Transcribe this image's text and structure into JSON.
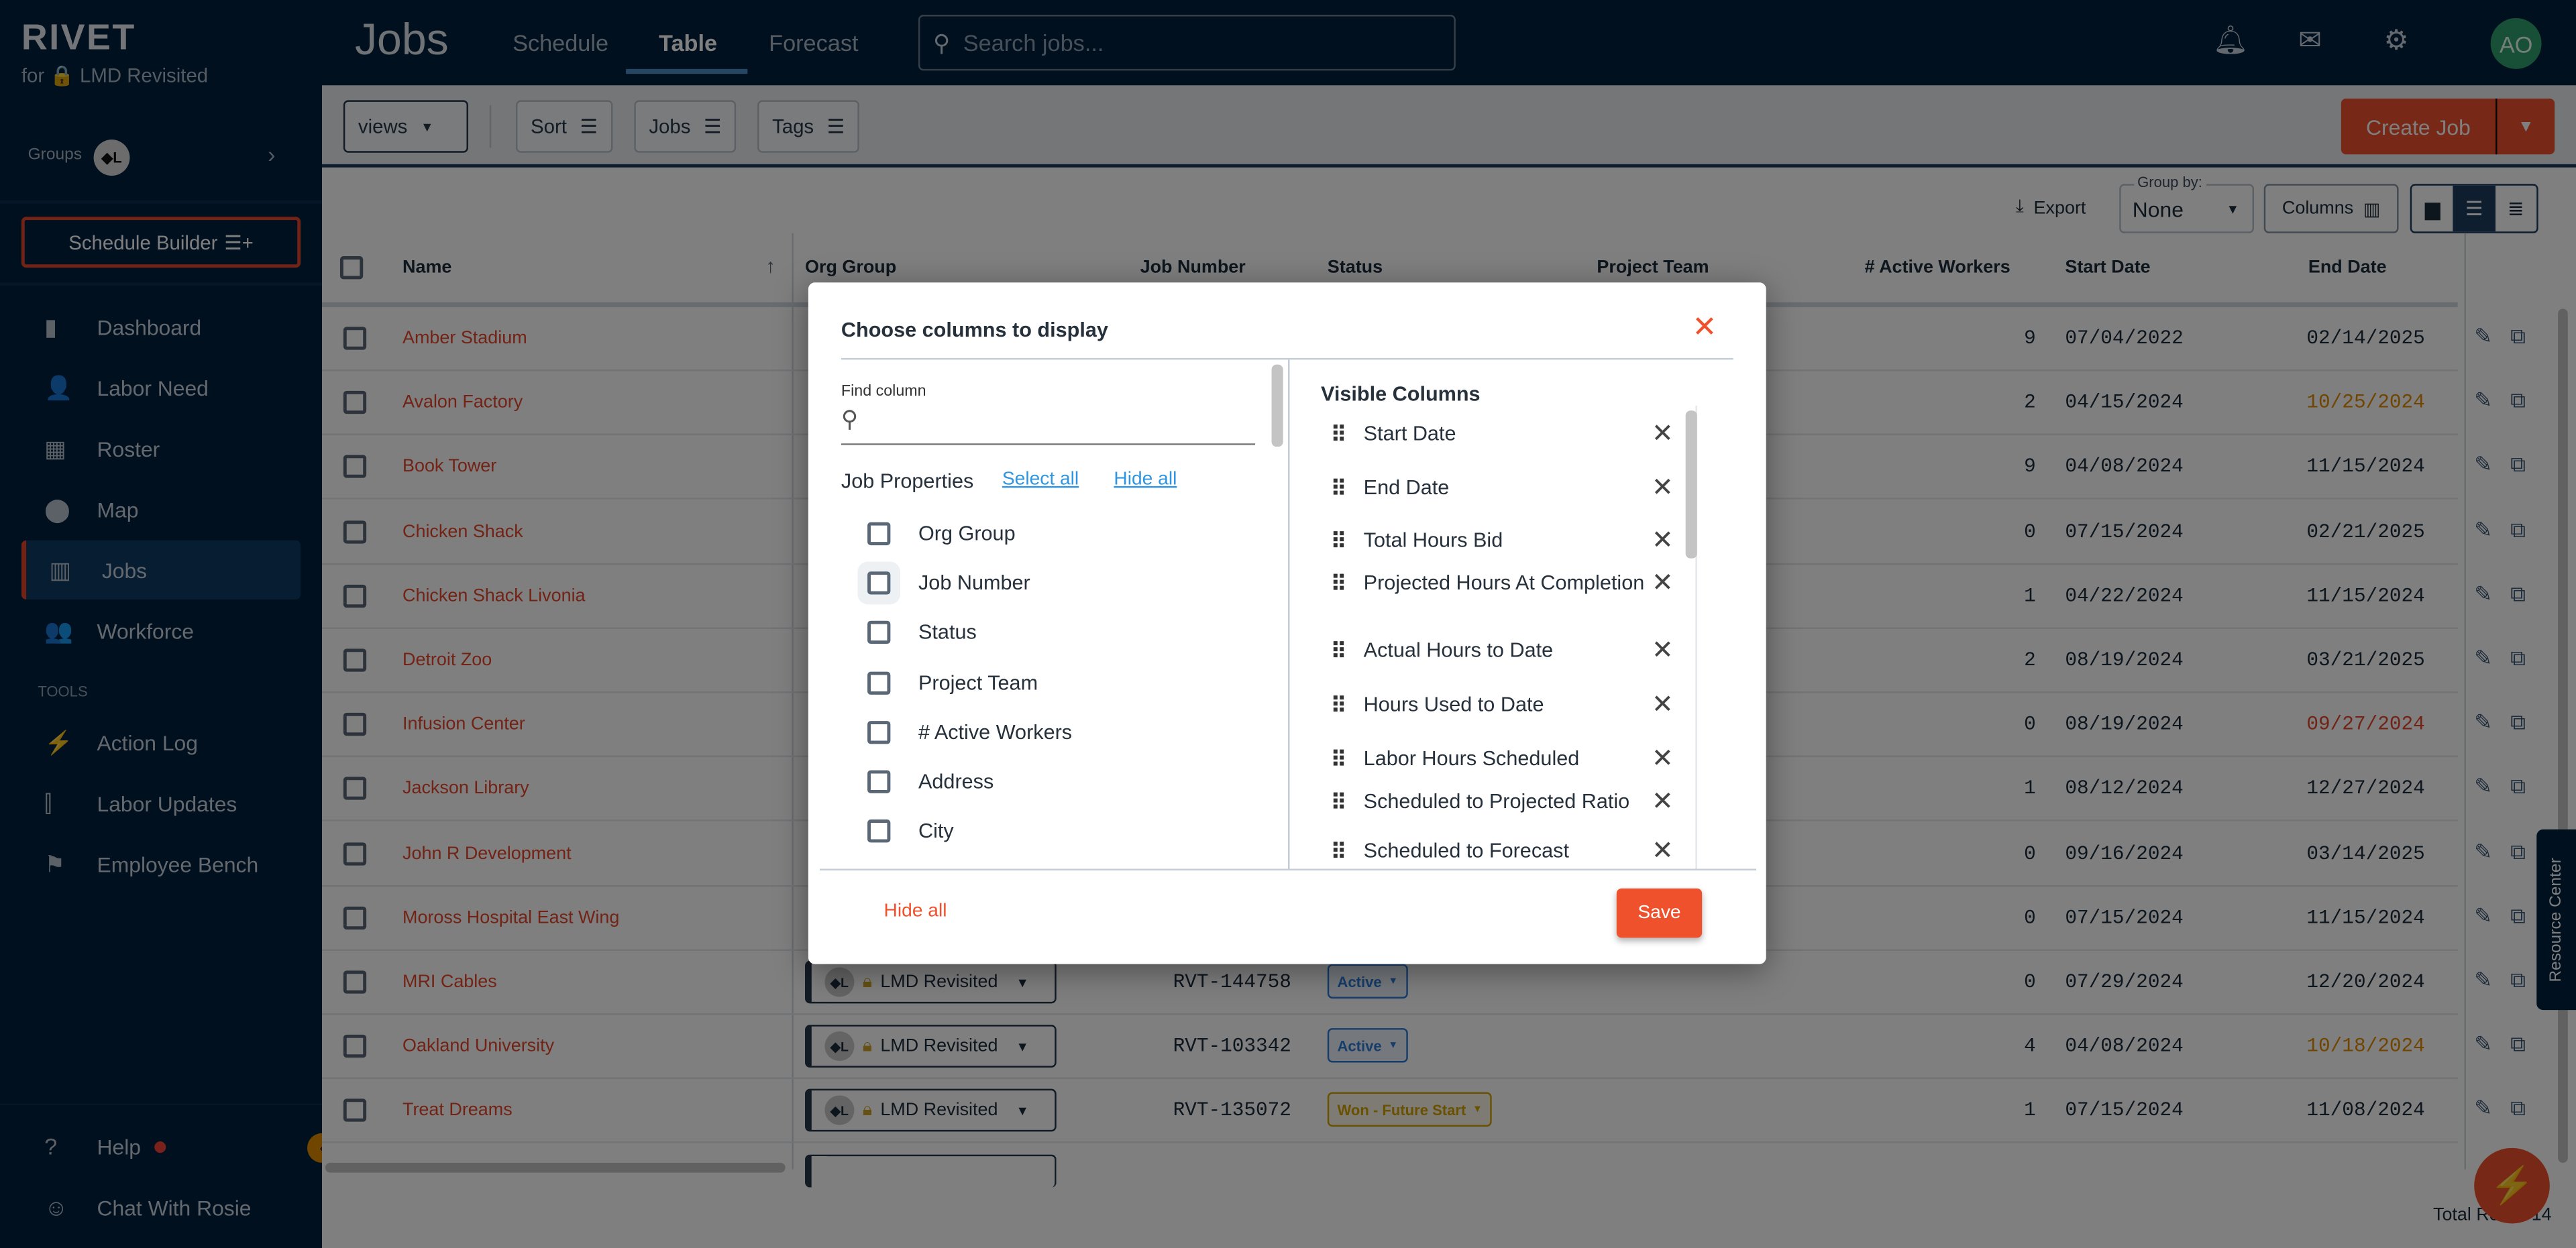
{
  "app": {
    "logo": "RIVET",
    "org_label": "for 🔒 LMD Revisited",
    "groups_label": "Groups",
    "group_avatar": "◆L"
  },
  "sidebar": {
    "schedule_builder": "Schedule Builder",
    "items": [
      {
        "label": "Dashboard",
        "icon": "bar-chart-icon",
        "glyph": "▮"
      },
      {
        "label": "Labor Need",
        "icon": "person-add-icon",
        "glyph": "👤"
      },
      {
        "label": "Roster",
        "icon": "table-icon",
        "glyph": "▦"
      },
      {
        "label": "Map",
        "icon": "map-pin-icon",
        "glyph": "⬤"
      },
      {
        "label": "Jobs",
        "icon": "building-icon",
        "glyph": "▥",
        "active": true
      },
      {
        "label": "Workforce",
        "icon": "people-icon",
        "glyph": "👥"
      }
    ],
    "tools_label": "TOOLS",
    "tools": [
      {
        "label": "Action Log",
        "icon": "bolt-icon",
        "glyph": "⚡"
      },
      {
        "label": "Labor Updates",
        "icon": "signal-icon",
        "glyph": "⫿"
      },
      {
        "label": "Employee Bench",
        "icon": "flag-icon",
        "glyph": "⚑"
      }
    ],
    "help": "Help",
    "chat": "Chat With Rosie"
  },
  "header": {
    "title": "Jobs",
    "tabs": [
      "Schedule",
      "Table",
      "Forecast"
    ],
    "active_tab": "Table",
    "search_placeholder": "Search jobs...",
    "avatar": "AO"
  },
  "toolbar": {
    "views": "views",
    "sort": "Sort",
    "jobs": "Jobs",
    "tags": "Tags",
    "create_job": "Create Job"
  },
  "table_controls": {
    "export": "Export",
    "group_by_label": "Group by:",
    "group_by_value": "None",
    "columns": "Columns"
  },
  "table": {
    "headers": [
      "Name",
      "Org Group",
      "Job Number",
      "Status",
      "Project Team",
      "# Active Workers",
      "Start Date",
      "End Date"
    ],
    "rows": [
      {
        "name": "Amber Stadium",
        "workers": "9",
        "start": "07/04/2022",
        "end": "02/14/2025",
        "end_color": "#1b2a3a"
      },
      {
        "name": "Avalon Factory",
        "workers": "2",
        "start": "04/15/2024",
        "end": "10/25/2024",
        "end_color": "#e08a00"
      },
      {
        "name": "Book Tower",
        "workers": "9",
        "start": "04/08/2024",
        "end": "11/15/2024",
        "end_color": "#1b2a3a"
      },
      {
        "name": "Chicken Shack",
        "workers": "0",
        "start": "07/15/2024",
        "end": "02/21/2025",
        "end_color": "#1b2a3a"
      },
      {
        "name": "Chicken Shack Livonia",
        "workers": "1",
        "start": "04/22/2024",
        "end": "11/15/2024",
        "end_color": "#1b2a3a"
      },
      {
        "name": "Detroit Zoo",
        "workers": "2",
        "start": "08/19/2024",
        "end": "03/21/2025",
        "end_color": "#1b2a3a"
      },
      {
        "name": "Infusion Center",
        "workers": "0",
        "start": "08/19/2024",
        "end": "09/27/2024",
        "end_color": "#e4472a"
      },
      {
        "name": "Jackson Library",
        "workers": "1",
        "start": "08/12/2024",
        "end": "12/27/2024",
        "end_color": "#1b2a3a"
      },
      {
        "name": "John R Development",
        "workers": "0",
        "start": "09/16/2024",
        "end": "03/14/2025",
        "end_color": "#1b2a3a"
      },
      {
        "name": "Moross Hospital East Wing",
        "workers": "0",
        "start": "07/15/2024",
        "end": "11/15/2024",
        "end_color": "#1b2a3a"
      },
      {
        "name": "MRI Cables",
        "org": "LMD Revisited",
        "job_number": "RVT-144758",
        "status": "Active",
        "status_color": "#2f7bd6",
        "workers": "0",
        "start": "07/29/2024",
        "end": "12/20/2024",
        "end_color": "#1b2a3a"
      },
      {
        "name": "Oakland University",
        "org": "LMD Revisited",
        "job_number": "RVT-103342",
        "status": "Active",
        "status_color": "#2f7bd6",
        "workers": "4",
        "start": "04/08/2024",
        "end": "10/18/2024",
        "end_color": "#e08a00"
      },
      {
        "name": "Treat Dreams",
        "org": "LMD Revisited",
        "job_number": "RVT-135072",
        "status": "Won - Future Start",
        "status_color": "#d4a300",
        "workers": "1",
        "start": "07/15/2024",
        "end": "11/08/2024",
        "end_color": "#1b2a3a"
      }
    ],
    "total": "Total Rows: 14"
  },
  "resource_center": "Resource Center",
  "modal": {
    "title": "Choose columns to display",
    "find_label": "Find column",
    "find_value": "",
    "section": "Job Properties",
    "select_all": "Select all",
    "hide_all_link": "Hide all",
    "properties": [
      {
        "label": "Org Group",
        "checked": false
      },
      {
        "label": "Job Number",
        "checked": false
      },
      {
        "label": "Status",
        "checked": false
      },
      {
        "label": "Project Team",
        "checked": false
      },
      {
        "label": "# Active Workers",
        "checked": false
      },
      {
        "label": "Address",
        "checked": false
      },
      {
        "label": "City",
        "checked": false
      }
    ],
    "visible_title": "Visible Columns",
    "visible": [
      "Start Date",
      "End Date",
      "Total Hours Bid",
      "Projected Hours At Completion",
      "Actual Hours to Date",
      "Hours Used to Date",
      "Labor Hours Scheduled",
      "Scheduled to Projected Ratio",
      "Scheduled to Forecast"
    ],
    "hide_all": "Hide all",
    "save": "Save"
  },
  "colors": {
    "brand_dark": "#03203d",
    "accent": "#f0512d",
    "link": "#2f95e0"
  }
}
